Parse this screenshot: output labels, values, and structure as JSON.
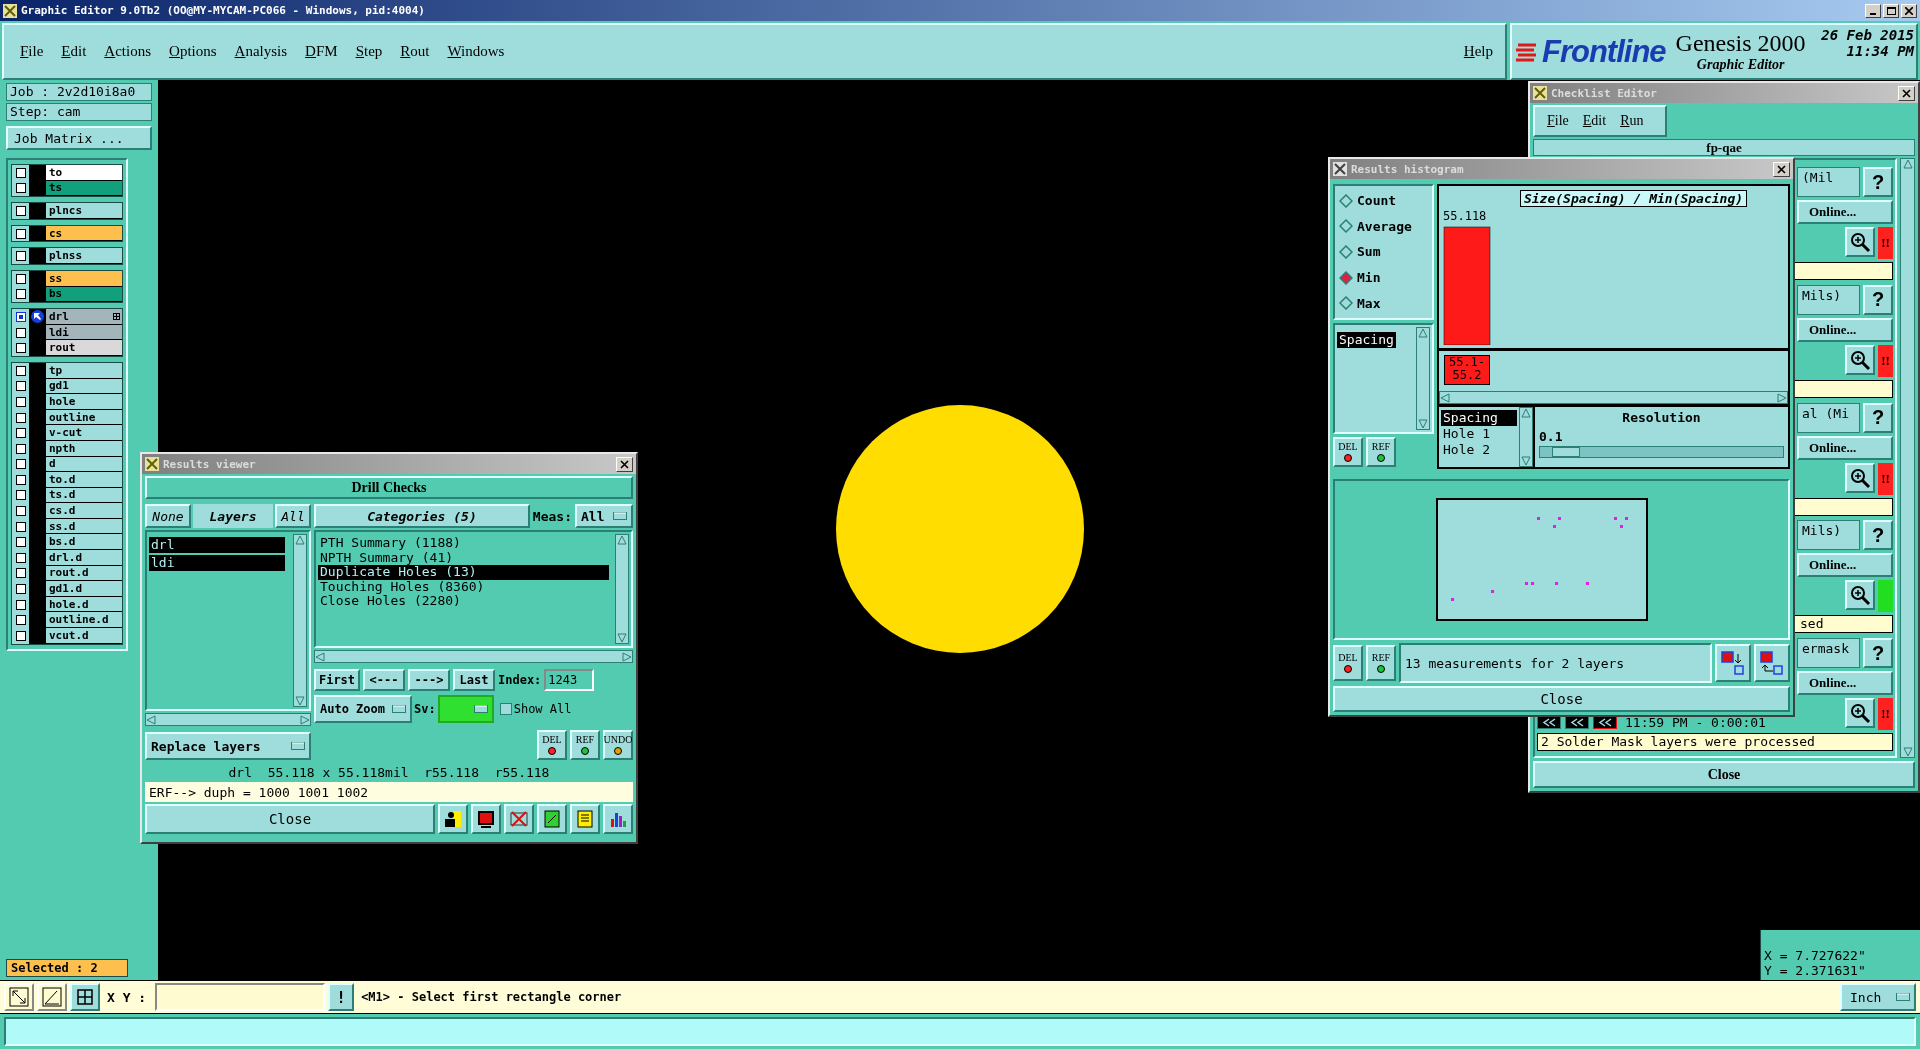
{
  "window": {
    "title": "Graphic Editor 9.0Tb2 (OO@MY-MYCAM-PC066 - Windows, pid:4004)"
  },
  "menu": [
    "File",
    "Edit",
    "Actions",
    "Options",
    "Analysis",
    "DFM",
    "Step",
    "Rout",
    "Windows"
  ],
  "help_menu": "Help",
  "brand": {
    "logo": "Frontline",
    "product": "Genesis 2000",
    "module": "Graphic Editor",
    "date": "26 Feb 2015",
    "time": "11:34 PM"
  },
  "job": {
    "job": "Job : 2v2d10i8a0",
    "step": "Step: cam",
    "matrix_button": "Job Matrix ..."
  },
  "layer_groups": [
    {
      "layers": [
        {
          "name": "to",
          "color": "#ffffff",
          "active": false
        },
        {
          "name": "ts",
          "color": "#12a07c",
          "active": false
        }
      ]
    },
    {
      "layers": [
        {
          "name": "plncs",
          "color": "#9fdcdc",
          "active": false
        }
      ]
    },
    {
      "layers": [
        {
          "name": "cs",
          "color": "#fdc04f",
          "active": false
        }
      ]
    },
    {
      "layers": [
        {
          "name": "plnss",
          "color": "#9fdcdc",
          "active": false
        }
      ]
    },
    {
      "layers": [
        {
          "name": "ss",
          "color": "#fdc04f",
          "active": false
        },
        {
          "name": "bs",
          "color": "#12a07c",
          "active": false
        }
      ]
    },
    {
      "layers": [
        {
          "name": "drl",
          "color": "#a3b5bb",
          "active": true
        },
        {
          "name": "ldi",
          "color": "#a3b5bb",
          "active": false
        },
        {
          "name": "rout",
          "color": "#d9d9d9",
          "active": false
        }
      ]
    },
    {
      "layers": [
        {
          "name": "tp",
          "color": "#9fdcdc",
          "active": false
        },
        {
          "name": "gd1",
          "color": "#9fdcdc",
          "active": false
        },
        {
          "name": "hole",
          "color": "#9fdcdc",
          "active": false
        },
        {
          "name": "outline",
          "color": "#9fdcdc",
          "active": false
        },
        {
          "name": "v-cut",
          "color": "#9fdcdc",
          "active": false
        },
        {
          "name": "npth",
          "color": "#9fdcdc",
          "active": false
        },
        {
          "name": "d",
          "color": "#9fdcdc",
          "active": false
        },
        {
          "name": "to.d",
          "color": "#9fdcdc",
          "active": false
        },
        {
          "name": "ts.d",
          "color": "#9fdcdc",
          "active": false
        },
        {
          "name": "cs.d",
          "color": "#9fdcdc",
          "active": false
        },
        {
          "name": "ss.d",
          "color": "#9fdcdc",
          "active": false
        },
        {
          "name": "bs.d",
          "color": "#9fdcdc",
          "active": false
        },
        {
          "name": "drl.d",
          "color": "#9fdcdc",
          "active": false
        },
        {
          "name": "rout.d",
          "color": "#9fdcdc",
          "active": false
        },
        {
          "name": "gd1.d",
          "color": "#9fdcdc",
          "active": false
        },
        {
          "name": "hole.d",
          "color": "#9fdcdc",
          "active": false
        },
        {
          "name": "outline.d",
          "color": "#9fdcdc",
          "active": false
        },
        {
          "name": "vcut.d",
          "color": "#9fdcdc",
          "active": false
        }
      ]
    }
  ],
  "selected_count": "Selected : 2",
  "coords": {
    "x": "X = 7.727622\"",
    "y": "Y = 2.371631\""
  },
  "command_bar": {
    "xy_label": "X Y :",
    "hint_button": "!",
    "prompt": "<M1> - Select first rectangle corner",
    "units": "Inch"
  },
  "results_viewer": {
    "title": "Results viewer",
    "header": "Drill Checks",
    "none_button": "None",
    "layers_label": "Layers",
    "all_button": "All",
    "layers": [
      {
        "name": "drl",
        "selected": true
      },
      {
        "name": "ldi",
        "selected": true
      }
    ],
    "categories_button": "Categories (5)",
    "meas_label": "Meas:",
    "meas_value": "All",
    "categories": [
      {
        "label": "PTH Summary (1188)",
        "selected": false
      },
      {
        "label": "NPTH Summary (41)",
        "selected": false
      },
      {
        "label": "Duplicate Holes (13)",
        "selected": true
      },
      {
        "label": "Touching Holes (8360)",
        "selected": false
      },
      {
        "label": "Close Holes (2280)",
        "selected": false
      }
    ],
    "nav": [
      "First",
      "<---",
      "--->",
      "Last"
    ],
    "index_label": "Index:",
    "index_value": "1243",
    "zoom_mode": "Auto Zoom",
    "sv_label": "Sv:",
    "show_all": {
      "label": "Show All",
      "checked": false
    },
    "replace_mode": "Replace layers",
    "actions": [
      "DEL",
      "REF",
      "UNDO"
    ],
    "info": "drl  55.118 x 55.118mil  r55.118  r55.118",
    "erf": "ERF--> duph = 1000 1001 1002",
    "close": "Close"
  },
  "histogram": {
    "title": "Results histogram",
    "modes": [
      {
        "label": "Count",
        "selected": false
      },
      {
        "label": "Average",
        "selected": false
      },
      {
        "label": "Sum",
        "selected": false
      },
      {
        "label": "Min",
        "selected": true
      },
      {
        "label": "Max",
        "selected": false
      }
    ],
    "attributes": [
      {
        "label": "Spacing",
        "selected": true
      }
    ],
    "chart": {
      "title": "Size(Spacing) / Min(Spacing)",
      "bins": [
        {
          "range": "55.1-55.2",
          "value": "55.118"
        }
      ]
    },
    "measures": [
      {
        "label": "Spacing",
        "selected": true
      },
      {
        "label": "Hole 1",
        "selected": false
      },
      {
        "label": "Hole 2",
        "selected": false
      }
    ],
    "resolution_label": "Resolution",
    "resolution_value": "0.1",
    "resolution": {
      "level": 0.05
    },
    "actions": [
      "DEL",
      "REF"
    ],
    "bottom_actions": [
      "DEL",
      "REF"
    ],
    "summary": "13 measurements for 2 layers",
    "close": "Close"
  },
  "checklist": {
    "title": "Checklist Editor",
    "menu": [
      "File",
      "Edit",
      "Run"
    ],
    "name": "fp-qae",
    "items": [
      {
        "title": "(Mil",
        "online": "Online...",
        "status": {
          "color": "#ff2020",
          "text": "!!"
        }
      },
      {
        "title": "Mils)",
        "online": "Online...",
        "status": {
          "color": "#ff2020",
          "text": "!!"
        }
      },
      {
        "title": "al (Mi",
        "online": "Online...",
        "status": {
          "color": "#ff2020",
          "text": "!!"
        }
      },
      {
        "title": "Mils)",
        "online": "Online...",
        "status": {
          "color": "#22dd22"
        },
        "message": "sed"
      },
      {
        "title": "ermask",
        "online": "Online...",
        "status": {
          "color": "#ff2020",
          "text": "!!"
        },
        "time": "11:59 PM - 0:00:01",
        "message": "2 Solder Mask layers were processed"
      }
    ],
    "help_button": "?",
    "close": "Close"
  }
}
